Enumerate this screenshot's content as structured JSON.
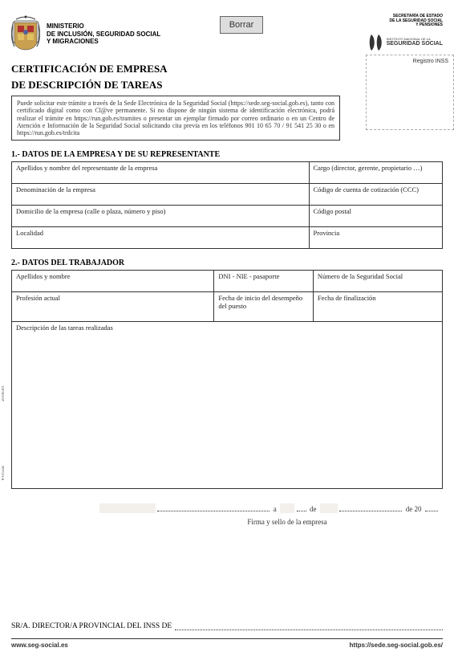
{
  "header": {
    "borrar": "Borrar",
    "ministerio_line1": "MINISTERIO",
    "ministerio_line2": "DE INCLUSIÓN, SEGURIDAD SOCIAL",
    "ministerio_line3": "Y MIGRACIONES",
    "secretaria_line1": "SECRETARÍA DE ESTADO",
    "secretaria_line2": "DE LA SEGURIDAD SOCIAL",
    "secretaria_line3": "Y PENSIONES",
    "ss_small": "INSTITUTO NACIONAL DE LA",
    "ss_big": "SEGURIDAD SOCIAL",
    "registro": "Registro INSS"
  },
  "title_line1": "CERTIFICACIÓN DE EMPRESA",
  "title_line2": "DE DESCRIPCIÓN DE TAREAS",
  "intro": "Puede solicitar este trámite a través de la Sede Electrónica de la Seguridad Social (https://sede.seg-social.gob.es), tanto con certificado digital como con Cl@ve permanente. Si no dispone de ningún sistema de identificación electrónica, podrá realizar el trámite en https://run.gob.es/tramites o presentar un ejemplar firmado por correo ordinario o en un Centro de Atención e Información de la Seguridad Social solicitando cita previa en los teléfonos 901 10 65 70 / 91 541 25 30 o en https://run.gob.es/trdcita",
  "section1": {
    "heading": "1.- DATOS DE LA EMPRESA Y DE SU REPRESENTANTE",
    "f_apellidos": "Apellidos y nombre del representante de la empresa",
    "f_cargo": "Cargo (director, gerente, propietario …)",
    "f_denominacion": "Denominación de la empresa",
    "f_ccc": "Código de cuenta de cotización (CCC)",
    "f_domicilio": "Domicilio de la empresa (calle o plaza, número y piso)",
    "f_cp": "Código postal",
    "f_localidad": "Localidad",
    "f_provincia": "Provincia"
  },
  "section2": {
    "heading": "2.- DATOS DEL TRABAJADOR",
    "f_apellidos": "Apellidos y nombre",
    "f_dni": "DNI - NIE - pasaporte",
    "f_nss": "Número de la Seguridad Social",
    "f_profesion": "Profesión actual",
    "f_fecha_inicio": "Fecha de inicio del desempeño del puesto",
    "f_fecha_fin": "Fecha de finalización",
    "f_descripcion": "Descripción de las tareas realizadas"
  },
  "dateline": {
    "a": "a",
    "de": "de",
    "de20": "de 20"
  },
  "firma": "Firma y sello de la empresa",
  "director": "SR/A. DIRECTOR/A PROVINCIAL DEL INSS DE",
  "footer_left": "www.seg-social.es",
  "footer_right": "https://sede.seg-social.gob.es/",
  "side_code1": "20190301",
  "side_code2": "8-015cas"
}
